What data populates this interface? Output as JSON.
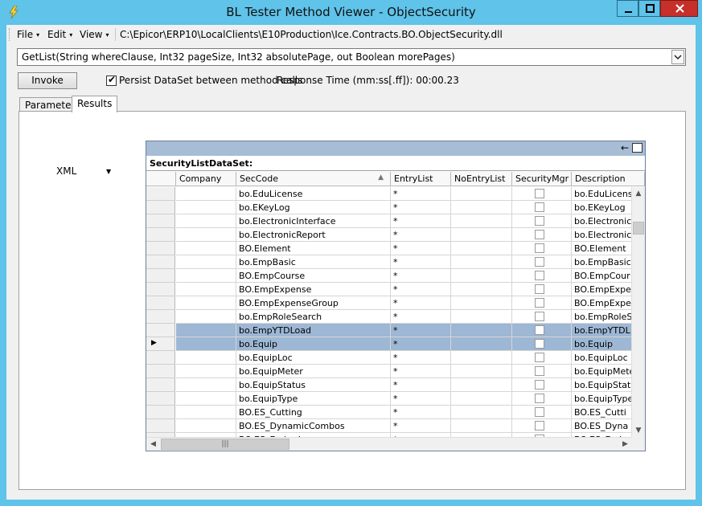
{
  "window": {
    "title": "BL Tester Method Viewer - ObjectSecurity",
    "minimize_glyph": "‒",
    "maximize_glyph": "□",
    "close_glyph": "✕"
  },
  "menu": {
    "file": "File",
    "edit": "Edit",
    "view": "View",
    "arrow": "▾",
    "dll_path": "C:\\Epicor\\ERP10\\LocalClients\\E10Production\\Ice.Contracts.BO.ObjectSecurity.dll"
  },
  "method_select": {
    "value": "GetList(String whereClause, Int32 pageSize, Int32 absolutePage, out Boolean morePages)",
    "arrow": "⌄"
  },
  "controls": {
    "invoke_label": "Invoke",
    "persist_checked": true,
    "check_mark": "✔",
    "persist_label": "Persist DataSet between method calls",
    "response_label": "Response Time (mm:ss[.ff]): 00:00.23"
  },
  "tabs": [
    {
      "label": "Parameters",
      "active": false
    },
    {
      "label": "Results",
      "active": true
    }
  ],
  "results": {
    "format": "XML",
    "format_arrow": "▼",
    "dataset_name": "SecurityListDataSet:",
    "nav_icon": "←",
    "sort_icon": "▲",
    "row_pointer": "▶",
    "columns": [
      "Company",
      "SecCode",
      "EntryList",
      "NoEntryList",
      "SecurityMgr",
      "Description"
    ],
    "rows": [
      {
        "seccode": "bo.EduLicense",
        "entrylist": "*",
        "desc": "bo.EduLicens",
        "highlight": false,
        "current": false
      },
      {
        "seccode": "bo.EKeyLog",
        "entrylist": "*",
        "desc": "bo.EKeyLog",
        "highlight": false,
        "current": false
      },
      {
        "seccode": "bo.ElectronicInterface",
        "entrylist": "*",
        "desc": "bo.Electronicl",
        "highlight": false,
        "current": false
      },
      {
        "seccode": "bo.ElectronicReport",
        "entrylist": "*",
        "desc": "bo.Electronic",
        "highlight": false,
        "current": false
      },
      {
        "seccode": "BO.Element",
        "entrylist": "*",
        "desc": "BO.Element",
        "highlight": false,
        "current": false
      },
      {
        "seccode": "bo.EmpBasic",
        "entrylist": "*",
        "desc": "bo.EmpBasic",
        "highlight": false,
        "current": false
      },
      {
        "seccode": "BO.EmpCourse",
        "entrylist": "*",
        "desc": "BO.EmpCour",
        "highlight": false,
        "current": false
      },
      {
        "seccode": "BO.EmpExpense",
        "entrylist": "*",
        "desc": "BO.EmpExpe",
        "highlight": false,
        "current": false
      },
      {
        "seccode": "BO.EmpExpenseGroup",
        "entrylist": "*",
        "desc": "BO.EmpExpe",
        "highlight": false,
        "current": false
      },
      {
        "seccode": "bo.EmpRoleSearch",
        "entrylist": "*",
        "desc": "bo.EmpRoleS",
        "highlight": false,
        "current": false
      },
      {
        "seccode": "bo.EmpYTDLoad",
        "entrylist": "*",
        "desc": "bo.EmpYTDL",
        "highlight": true,
        "current": false
      },
      {
        "seccode": "bo.Equip",
        "entrylist": "*",
        "desc": "bo.Equip",
        "highlight": true,
        "current": true
      },
      {
        "seccode": "bo.EquipLoc",
        "entrylist": "*",
        "desc": "bo.EquipLoc",
        "highlight": false,
        "current": false
      },
      {
        "seccode": "bo.EquipMeter",
        "entrylist": "*",
        "desc": "bo.EquipMete",
        "highlight": false,
        "current": false
      },
      {
        "seccode": "bo.EquipStatus",
        "entrylist": "*",
        "desc": "bo.EquipStat",
        "highlight": false,
        "current": false
      },
      {
        "seccode": "bo.EquipType",
        "entrylist": "*",
        "desc": "bo.EquipType",
        "highlight": false,
        "current": false
      },
      {
        "seccode": "BO.ES_Cutting",
        "entrylist": "*",
        "desc": "BO.ES_Cutti",
        "highlight": false,
        "current": false
      },
      {
        "seccode": "BO.ES_DynamicCombos",
        "entrylist": "*",
        "desc": "BO.ES_Dyna",
        "highlight": false,
        "current": false
      },
      {
        "seccode": "BO.ES_Embed",
        "entrylist": "*",
        "desc": "BO.ES_Emb",
        "highlight": false,
        "current": false
      }
    ],
    "scroll_up": "▲",
    "scroll_down": "▼",
    "scroll_left": "◀",
    "scroll_right": "▶",
    "scroll_grip": "|||"
  }
}
